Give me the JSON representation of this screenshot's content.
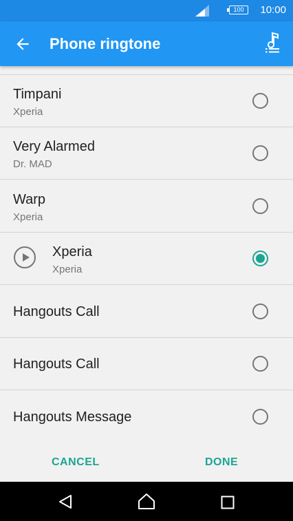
{
  "status_bar": {
    "battery": "100",
    "time": "10:00",
    "icons": [
      "signal-icon",
      "battery-icon"
    ]
  },
  "app_bar": {
    "title": "Phone ringtone",
    "icons": [
      "back-arrow-icon",
      "music-library-icon"
    ]
  },
  "ringtones": [
    {
      "title": "Timpani",
      "subtitle": "Xperia",
      "selected": false
    },
    {
      "title": "Very Alarmed",
      "subtitle": "Dr. MAD",
      "selected": false
    },
    {
      "title": "Warp",
      "subtitle": "Xperia",
      "selected": false
    },
    {
      "title": "Xperia",
      "subtitle": "Xperia",
      "selected": true,
      "playable": true
    },
    {
      "title": "Hangouts Call",
      "subtitle": "",
      "selected": false
    },
    {
      "title": "Hangouts Call",
      "subtitle": "",
      "selected": false
    },
    {
      "title": "Hangouts Message",
      "subtitle": "",
      "selected": false
    }
  ],
  "actions": {
    "cancel_label": "CANCEL",
    "done_label": "DONE"
  },
  "nav_bar": {
    "icons": [
      "back-nav-icon",
      "home-nav-icon",
      "recents-nav-icon"
    ]
  },
  "colors": {
    "status_bar": "#1e88e5",
    "app_bar": "#2196f3",
    "accent": "#1aa592",
    "background": "#f1f1f1"
  }
}
